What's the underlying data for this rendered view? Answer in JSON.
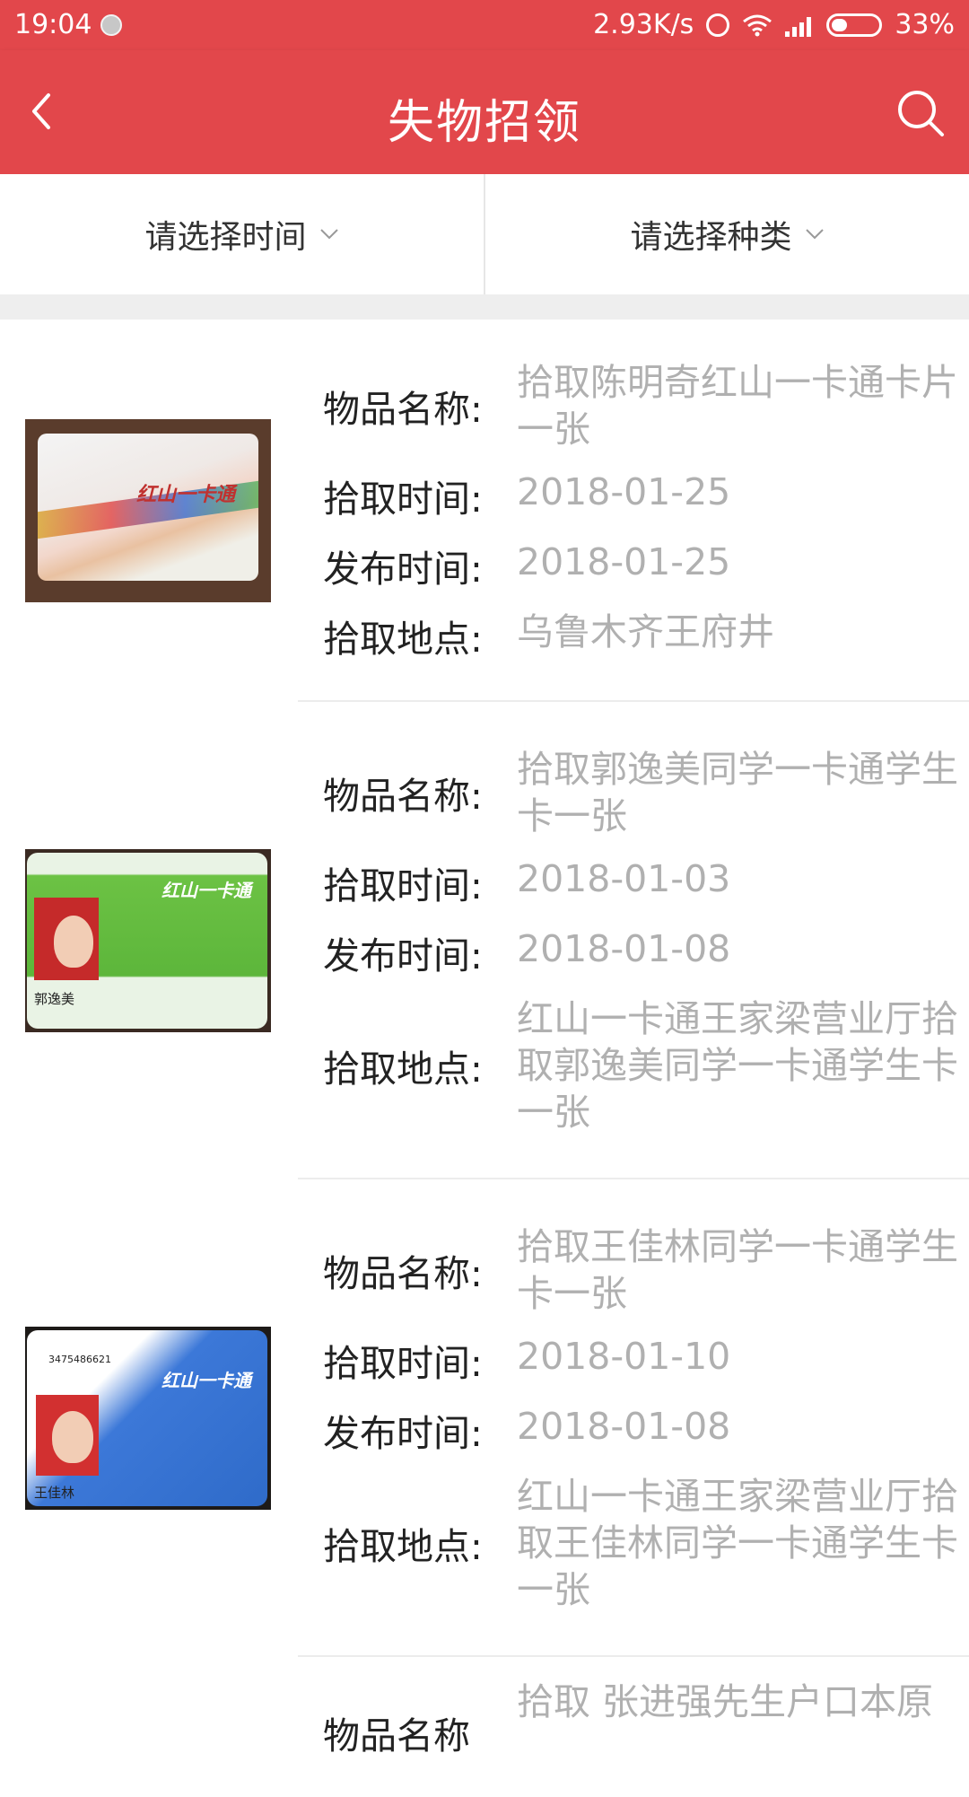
{
  "status_bar": {
    "time": "19:04",
    "network_speed": "2.93K/s",
    "battery_percent": "33%",
    "battery_level": 0.33,
    "icons": [
      "notification-icon",
      "alarm-icon",
      "wifi-icon",
      "signal-icon",
      "battery-icon"
    ]
  },
  "header": {
    "title": "失物招领",
    "back_icon": "chevron-left-icon",
    "search_icon": "search-icon"
  },
  "filters": [
    {
      "label": "请选择时间",
      "icon": "chevron-down-icon"
    },
    {
      "label": "请选择种类",
      "icon": "chevron-down-icon"
    }
  ],
  "field_labels": {
    "name": "物品名称:",
    "found_time": "拾取时间:",
    "publish_time": "发布时间:",
    "location": "拾取地点:"
  },
  "items": [
    {
      "name": "拾取陈明奇红山一卡通卡片一张",
      "found_time": "2018-01-25",
      "publish_time": "2018-01-25",
      "location": "乌鲁木齐王府井",
      "card_logo": "红山一卡通"
    },
    {
      "name": "拾取郭逸美同学一卡通学生卡一张",
      "found_time": "2018-01-03",
      "publish_time": "2018-01-08",
      "location": "红山一卡通王家梁营业厅拾取郭逸美同学一卡通学生卡一张",
      "card_logo": "红山一卡通",
      "card_name": "郭逸美"
    },
    {
      "name": "拾取王佳林同学一卡通学生卡一张",
      "found_time": "2018-01-10",
      "publish_time": "2018-01-08",
      "location": "红山一卡通王家梁营业厅拾取王佳林同学一卡通学生卡一张",
      "card_logo": "红山一卡通",
      "card_name": "王佳林",
      "card_number": "3475486621"
    },
    {
      "name": "拾取 张进强先生户口本原",
      "field_label_partial": "物品名称"
    }
  ]
}
